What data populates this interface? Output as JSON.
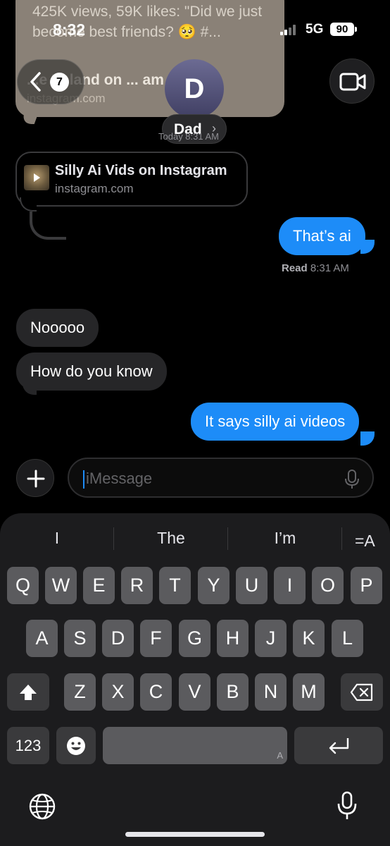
{
  "status_bar": {
    "time": "8:32",
    "network": "5G",
    "battery": "90"
  },
  "nav": {
    "back_count": "7",
    "contact_initial": "D",
    "contact_name": "Dad"
  },
  "top_preview": {
    "description": "425K views, 59K likes: \"Did we just become best friends? 🥺 #...",
    "title": "...e Ireland on ... am",
    "url": "instagram.com"
  },
  "timestamp_under_header": "Today 8:31 AM",
  "link_preview": {
    "title": "Silly Ai Vids on Instagram",
    "url": "instagram.com"
  },
  "messages": [
    {
      "from": "me",
      "text": "That’s ai"
    },
    {
      "from": "them",
      "text": "Nooooo"
    },
    {
      "from": "them",
      "text": "How do you know"
    },
    {
      "from": "me",
      "text": "It says silly ai videos"
    }
  ],
  "read_receipt": {
    "label": "Read",
    "time": "8:31 AM"
  },
  "compose": {
    "placeholder": "iMessage"
  },
  "keyboard": {
    "suggestions": [
      "I",
      "The",
      "I’m"
    ],
    "row1": [
      "Q",
      "W",
      "E",
      "R",
      "T",
      "Y",
      "U",
      "I",
      "O",
      "P"
    ],
    "row2": [
      "A",
      "S",
      "D",
      "F",
      "G",
      "H",
      "J",
      "K",
      "L"
    ],
    "row3": [
      "Z",
      "X",
      "C",
      "V",
      "B",
      "N",
      "M"
    ],
    "numbers_key": "123",
    "space_hint": "A"
  },
  "icons": [
    "back-chevron-icon",
    "video-camera-icon",
    "plus-icon",
    "microphone-icon",
    "shift-icon",
    "delete-icon",
    "emoji-icon",
    "return-icon",
    "globe-icon",
    "format-text-icon"
  ]
}
